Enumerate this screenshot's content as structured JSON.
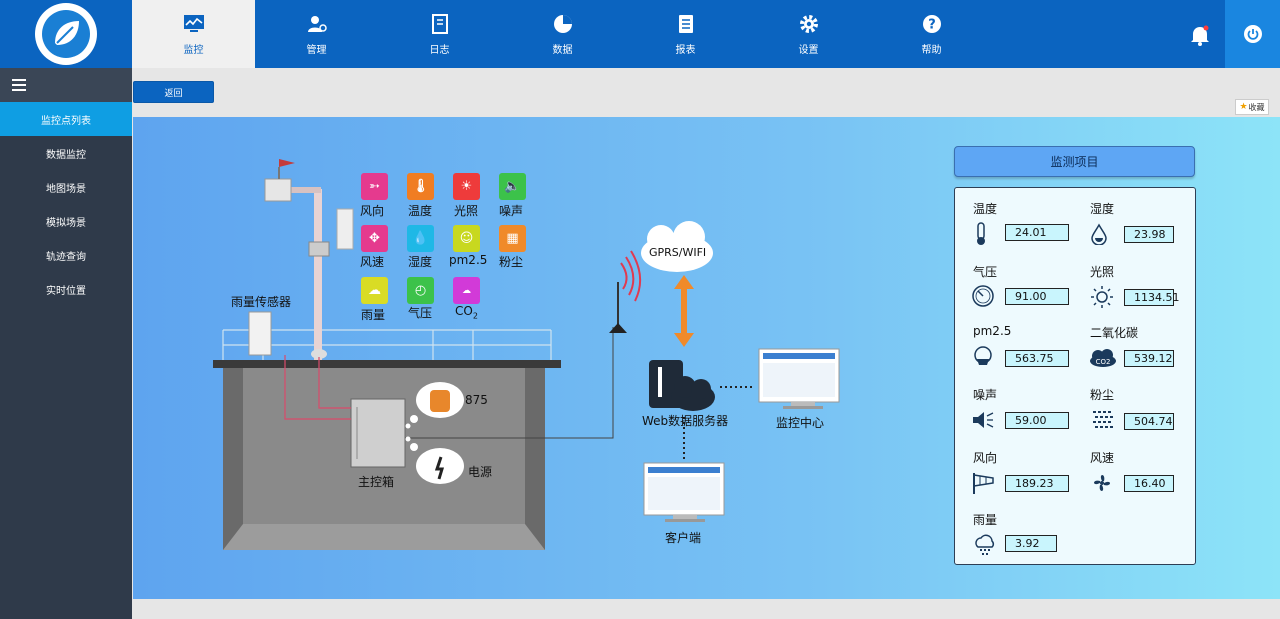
{
  "nav": {
    "items": [
      {
        "label": "监控"
      },
      {
        "label": "管理"
      },
      {
        "label": "日志"
      },
      {
        "label": "数据"
      },
      {
        "label": "报表"
      },
      {
        "label": "设置"
      },
      {
        "label": "帮助"
      }
    ]
  },
  "sidebar": {
    "items": [
      {
        "label": "监控点列表"
      },
      {
        "label": "数据监控"
      },
      {
        "label": "地图场景"
      },
      {
        "label": "模拟场景"
      },
      {
        "label": "轨迹查询"
      },
      {
        "label": "实时位置"
      }
    ]
  },
  "toolbar": {
    "back_label": "返回",
    "fav_label": "收藏"
  },
  "scene": {
    "sensor_icons": [
      {
        "label": "风向",
        "color": "#e53a8e"
      },
      {
        "label": "温度",
        "color": "#f07d22"
      },
      {
        "label": "光照",
        "color": "#ee3b3b"
      },
      {
        "label": "噪声",
        "color": "#3cc24a"
      },
      {
        "label": "风速",
        "color": "#e53a8e"
      },
      {
        "label": "湿度",
        "color": "#1fb8e6"
      },
      {
        "label": "pm2.5",
        "color": "#c8d81f"
      },
      {
        "label": "粉尘",
        "color": "#f08a2a"
      },
      {
        "label": "雨量",
        "color": "#d9dc25"
      },
      {
        "label": "气压",
        "color": "#3cc24a"
      },
      {
        "label": "CO",
        "sub": "2",
        "color": "#d23ad8"
      }
    ],
    "rain_sensor_label": "雨量传感器",
    "battery_value": "875",
    "power_label": "电源",
    "main_box_label": "主控箱",
    "gprs_label": "GPRS/WIFI",
    "server_label": "Web数据服务器",
    "monitor_center_label": "监控中心",
    "client_label": "客户端"
  },
  "panel": {
    "title": "监测项目",
    "items": [
      {
        "name": "温度",
        "value": "24.01",
        "icon": "thermometer-icon"
      },
      {
        "name": "湿度",
        "value": "23.98",
        "icon": "humidity-icon"
      },
      {
        "name": "气压",
        "value": "91.00",
        "icon": "pressure-gauge-icon"
      },
      {
        "name": "光照",
        "value": "1134.51",
        "icon": "sun-icon"
      },
      {
        "name": "pm2.5",
        "value": "563.75",
        "icon": "mask-icon"
      },
      {
        "name": "二氧化碳",
        "value": "539.12",
        "icon": "co2-cloud-icon"
      },
      {
        "name": "噪声",
        "value": "59.00",
        "icon": "speaker-icon"
      },
      {
        "name": "粉尘",
        "value": "504.74",
        "icon": "dust-icon"
      },
      {
        "name": "风向",
        "value": "189.23",
        "icon": "windsock-icon"
      },
      {
        "name": "风速",
        "value": "16.40",
        "icon": "fan-icon"
      },
      {
        "name": "雨量",
        "value": "3.92",
        "icon": "rain-cloud-icon"
      }
    ]
  },
  "colors": {
    "header": "#0b64c0",
    "sidebar": "#2f3a4a",
    "sidebar_active": "#0f9ee3",
    "accent": "#1a86e0"
  }
}
